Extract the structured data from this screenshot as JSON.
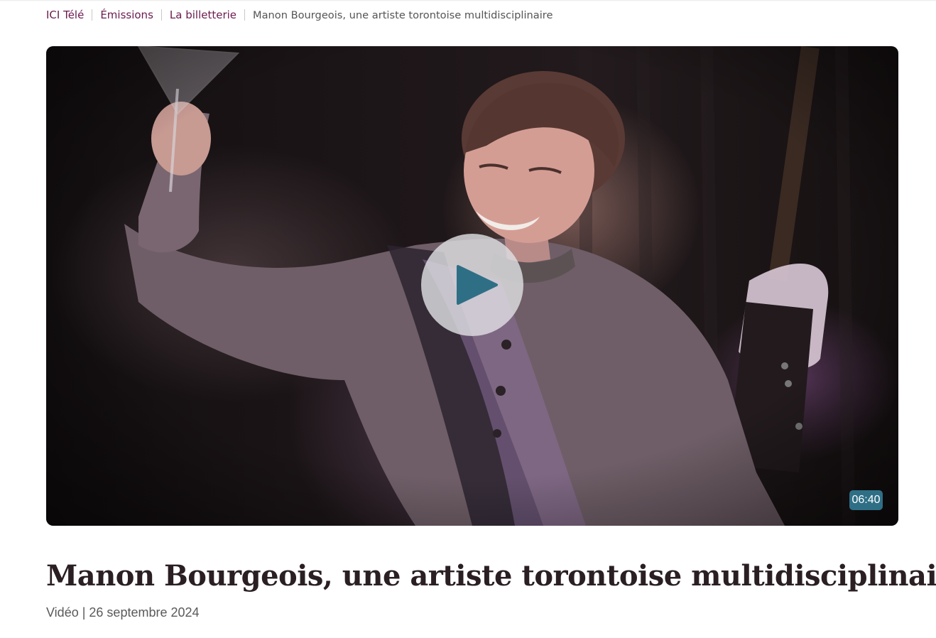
{
  "breadcrumb": {
    "items": [
      "ICI Télé",
      "Émissions",
      "La billetterie"
    ],
    "current": "Manon Bourgeois, une artiste torontoise multidisciplinaire"
  },
  "video": {
    "duration": "06:40",
    "accent_color": "#2f6f86",
    "play_icon": "play-icon"
  },
  "article": {
    "title": "Manon Bourgeois, une artiste torontoise multidisciplinaire",
    "type": "Vidéo",
    "separator": "|",
    "date": "26 septembre 2024"
  },
  "colors": {
    "link": "#6b1a4f",
    "title": "#2a1f22",
    "meta": "#5a5a5a"
  }
}
